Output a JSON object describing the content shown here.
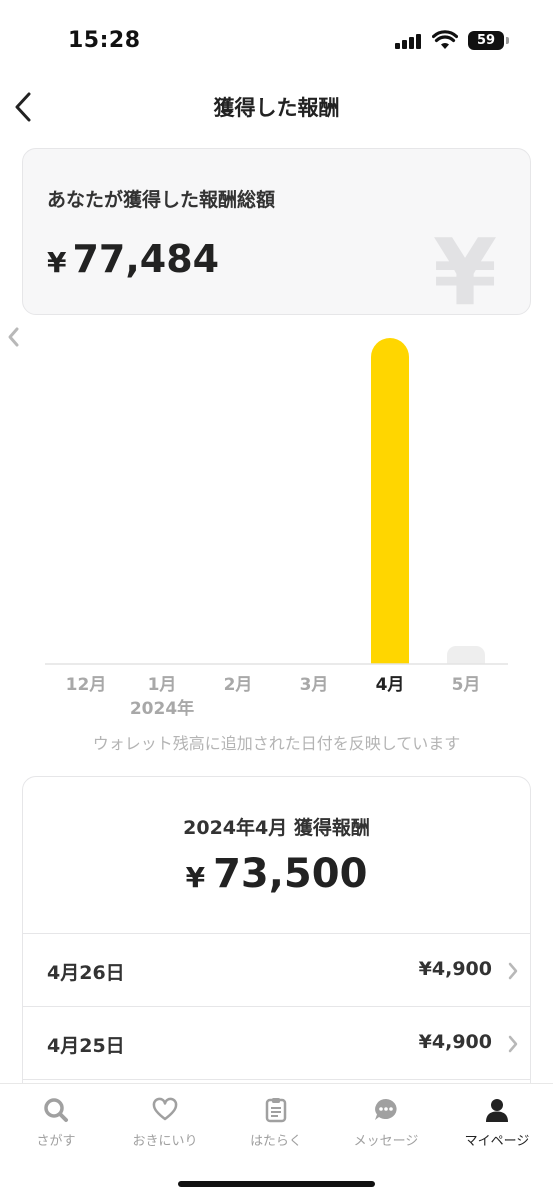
{
  "status_bar": {
    "time": "15:28",
    "battery": "59"
  },
  "header": {
    "title": "獲得した報酬"
  },
  "total": {
    "label": "あなたが獲得した報酬総額",
    "currency": "¥",
    "amount": "77,484",
    "watermark": "¥"
  },
  "chart_data": {
    "type": "bar",
    "categories": [
      "12月",
      "1月",
      "2月",
      "3月",
      "4月",
      "5月"
    ],
    "year_label": "2024年",
    "values": [
      0,
      0,
      0,
      0,
      73500,
      0
    ],
    "selected_index": 4,
    "colors": {
      "selected": "#FFD600",
      "muted": "#EEEEEE",
      "axis": "#E3E3E3"
    }
  },
  "chart_note": "ウォレット残高に追加された日付を反映しています",
  "month_summary": {
    "title": "2024年4月 獲得報酬",
    "currency": "¥",
    "amount": "73,500",
    "rows": [
      {
        "date": "4月26日",
        "amount": "¥4,900"
      },
      {
        "date": "4月25日",
        "amount": "¥4,900"
      }
    ]
  },
  "tabs": [
    {
      "label": "さがす",
      "icon": "search-icon"
    },
    {
      "label": "おきにいり",
      "icon": "heart-icon"
    },
    {
      "label": "はたらく",
      "icon": "clipboard-icon"
    },
    {
      "label": "メッセージ",
      "icon": "chat-bubble-icon"
    },
    {
      "label": "マイページ",
      "icon": "person-icon",
      "active": true
    }
  ]
}
